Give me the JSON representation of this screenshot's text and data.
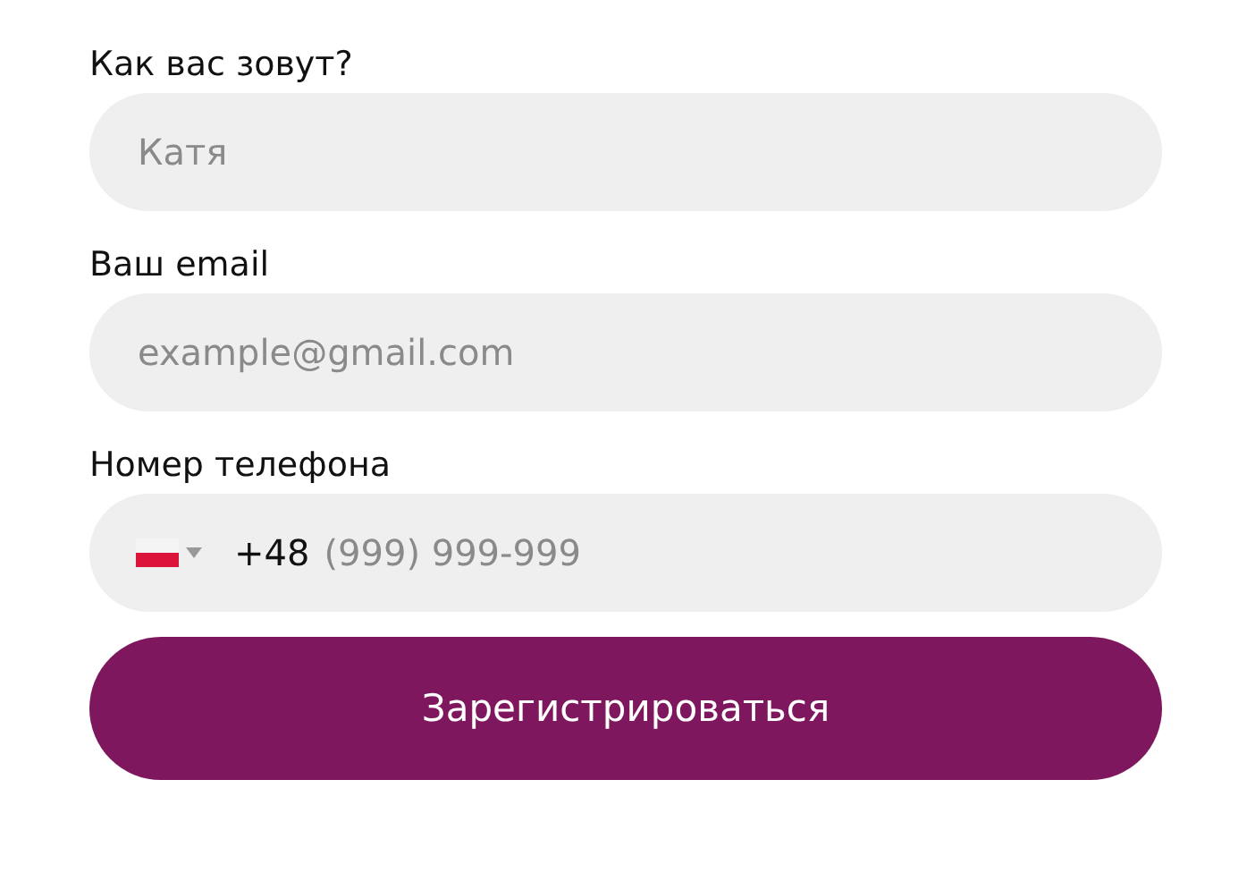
{
  "fields": [
    {
      "label": "Как вас зовут?",
      "placeholder": "Катя"
    },
    {
      "label": "Ваш email",
      "placeholder": "example@gmail.com"
    }
  ],
  "phone": {
    "label": "Номер телефона",
    "code": "+48",
    "placeholder": "(999) 999-999"
  },
  "submit": "Зарегистрироваться"
}
